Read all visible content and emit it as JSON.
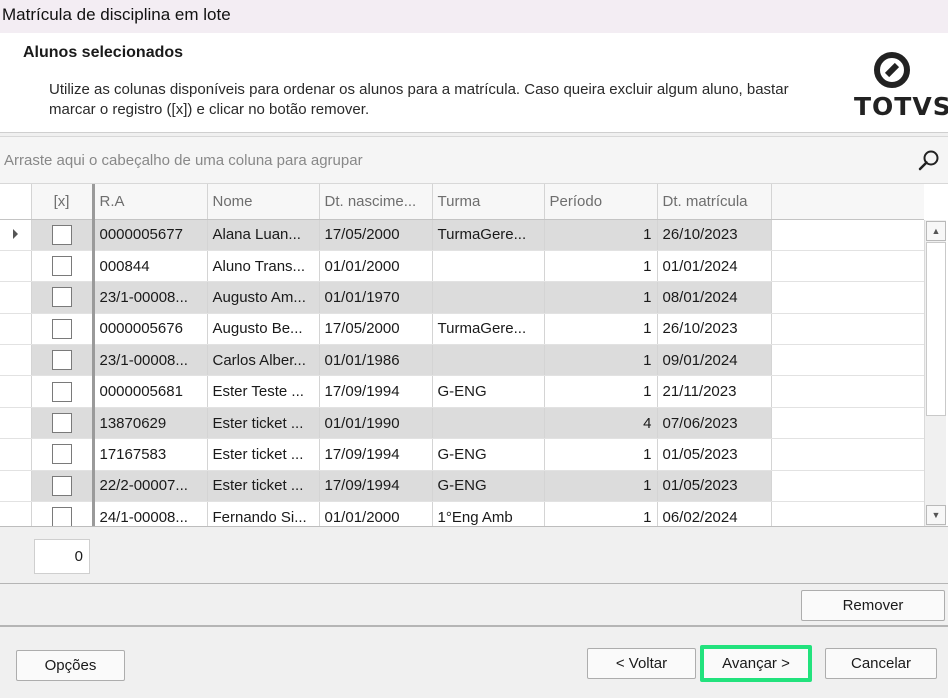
{
  "window": {
    "title": "Matrícula de disciplina em lote"
  },
  "header": {
    "title": "Alunos selecionados",
    "description": "Utilize as colunas disponíveis para ordenar os alunos para a matrícula. Caso queira excluir algum aluno, bastar marcar o registro ([x]) e clicar no botão remover.",
    "logo_text": "TOTVS"
  },
  "group_bar": {
    "placeholder": "Arraste aqui o cabeçalho de uma coluna para agrupar",
    "icon": "search-icon"
  },
  "columns": [
    "[x]",
    "R.A",
    "Nome",
    "Dt. nascime...",
    "Turma",
    "Período",
    "Dt. matrícula"
  ],
  "rows": [
    {
      "ra": "0000005677",
      "nome": "Alana Luan...",
      "nasc": "17/05/2000",
      "turma": "TurmaGere...",
      "periodo": "1",
      "matricula": "26/10/2023"
    },
    {
      "ra": "000844",
      "nome": "Aluno Trans...",
      "nasc": "01/01/2000",
      "turma": "",
      "periodo": "1",
      "matricula": "01/01/2024"
    },
    {
      "ra": "23/1-00008...",
      "nome": "Augusto Am...",
      "nasc": "01/01/1970",
      "turma": "",
      "periodo": "1",
      "matricula": "08/01/2024"
    },
    {
      "ra": "0000005676",
      "nome": "Augusto Be...",
      "nasc": "17/05/2000",
      "turma": "TurmaGere...",
      "periodo": "1",
      "matricula": "26/10/2023"
    },
    {
      "ra": "23/1-00008...",
      "nome": "Carlos Alber...",
      "nasc": "01/01/1986",
      "turma": "",
      "periodo": "1",
      "matricula": "09/01/2024"
    },
    {
      "ra": "0000005681",
      "nome": "Ester Teste ...",
      "nasc": "17/09/1994",
      "turma": "G-ENG",
      "periodo": "1",
      "matricula": "21/11/2023"
    },
    {
      "ra": "13870629",
      "nome": "Ester ticket ...",
      "nasc": "01/01/1990",
      "turma": "",
      "periodo": "4",
      "matricula": "07/06/2023"
    },
    {
      "ra": "17167583",
      "nome": "Ester ticket ...",
      "nasc": "17/09/1994",
      "turma": "G-ENG",
      "periodo": "1",
      "matricula": "01/05/2023"
    },
    {
      "ra": "22/2-00007...",
      "nome": "Ester ticket ...",
      "nasc": "17/09/1994",
      "turma": "G-ENG",
      "periodo": "1",
      "matricula": "01/05/2023"
    },
    {
      "ra": "24/1-00008...",
      "nome": "Fernando Si...",
      "nasc": "01/01/2000",
      "turma": "1°Eng Amb",
      "periodo": "1",
      "matricula": "06/02/2024"
    }
  ],
  "counter": "0",
  "buttons": {
    "remover": "Remover",
    "opcoes": "Opções",
    "voltar": "< Voltar",
    "avancar": "Avançar >",
    "cancelar": "Cancelar"
  },
  "colors": {
    "highlight": "#22e27d",
    "alt_row": "#dcdcdc"
  }
}
